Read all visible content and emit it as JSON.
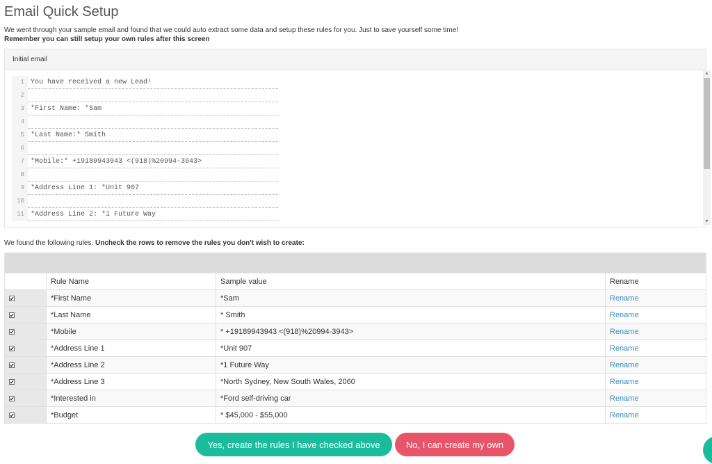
{
  "page": {
    "title": "Email Quick Setup",
    "intro_line1": "We went through your sample email and found that we could auto extract some data and setup these rules for you. Just to save yourself some time!",
    "intro_line2": "Remember you can still setup your own rules after this screen"
  },
  "email_panel": {
    "header": "Initial email",
    "lines": [
      {
        "num": "1",
        "text": "You have received a new Lead!"
      },
      {
        "num": "2",
        "text": ""
      },
      {
        "num": "3",
        "text": "*First Name: *Sam"
      },
      {
        "num": "4",
        "text": ""
      },
      {
        "num": "5",
        "text": "*Last Name:* Smith"
      },
      {
        "num": "6",
        "text": ""
      },
      {
        "num": "7",
        "text": "*Mobile:* +19189943943 <(918)%20994-3943>"
      },
      {
        "num": "8",
        "text": ""
      },
      {
        "num": "9",
        "text": "*Address Line 1: *Unit 907"
      },
      {
        "num": "10",
        "text": ""
      },
      {
        "num": "11",
        "text": "*Address Line 2: *1 Future Way"
      }
    ]
  },
  "found": {
    "text_plain": "We found the following rules. ",
    "text_bold": "Uncheck the rows to remove the rules you don't wish to create:"
  },
  "table": {
    "headers": {
      "name": "Rule Name",
      "value": "Sample value",
      "rename": "Rename"
    },
    "rows": [
      {
        "checked": "✔",
        "name": "*First Name",
        "value": "*Sam",
        "rename": "Rename"
      },
      {
        "checked": "✔",
        "name": "*Last Name",
        "value": "* Smith",
        "rename": "Rename"
      },
      {
        "checked": "✔",
        "name": "*Mobile",
        "value": "* +19189943943 <(918)%20994-3943>",
        "rename": "Rename"
      },
      {
        "checked": "✔",
        "name": "*Address Line 1",
        "value": "*Unit 907",
        "rename": "Rename"
      },
      {
        "checked": "✔",
        "name": "*Address Line 2",
        "value": "*1 Future Way",
        "rename": "Rename"
      },
      {
        "checked": "✔",
        "name": "*Address Line 3",
        "value": "*North Sydney, New South Wales, 2060",
        "rename": "Rename"
      },
      {
        "checked": "✔",
        "name": "*Interested in",
        "value": "*Ford self-driving car",
        "rename": "Rename"
      },
      {
        "checked": "✔",
        "name": "*Budget",
        "value": "* $45,000 - $55,000",
        "rename": "Rename"
      }
    ]
  },
  "buttons": {
    "yes_label": "Yes, create the rules I have checked above",
    "no_label": "No, I can create my own"
  },
  "colors": {
    "accent_green": "#1abc9c",
    "accent_red": "#e8556a",
    "link": "#3c8dbc"
  }
}
